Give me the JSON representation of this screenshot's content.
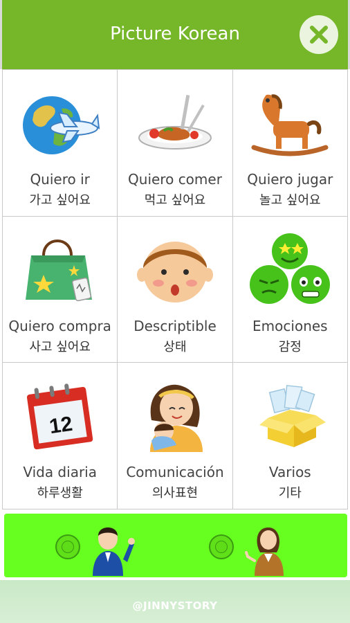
{
  "header": {
    "title": "Picture Korean"
  },
  "categories": [
    {
      "label": "Quiero ir",
      "korean": "가고 싶어요",
      "icon": "globe-airplane-icon"
    },
    {
      "label": "Quiero comer",
      "korean": "먹고 싶어요",
      "icon": "food-plate-icon"
    },
    {
      "label": "Quiero jugar",
      "korean": "놀고 싶어요",
      "icon": "rocking-horse-icon"
    },
    {
      "label": "Quiero compra",
      "korean": "사고 싶어요",
      "icon": "shopping-bag-icon"
    },
    {
      "label": "Descriptible",
      "korean": "상태",
      "icon": "child-face-icon"
    },
    {
      "label": "Emociones",
      "korean": "감정",
      "icon": "emotion-faces-icon"
    },
    {
      "label": "Vida diaria",
      "korean": "하루생활",
      "icon": "calendar-icon"
    },
    {
      "label": "Comunicación",
      "korean": "의사표현",
      "icon": "mother-baby-icon"
    },
    {
      "label": "Varios",
      "korean": "기타",
      "icon": "open-box-icon"
    }
  ],
  "calendar_day": "12",
  "voice_options": [
    {
      "icon": "male-avatar-icon"
    },
    {
      "icon": "female-avatar-icon"
    }
  ],
  "footer": {
    "credit": "@JINNYSTORY"
  },
  "colors": {
    "header": "#76b72a",
    "gender_bar": "#66ff1f",
    "footer": "#d2ecd0"
  }
}
